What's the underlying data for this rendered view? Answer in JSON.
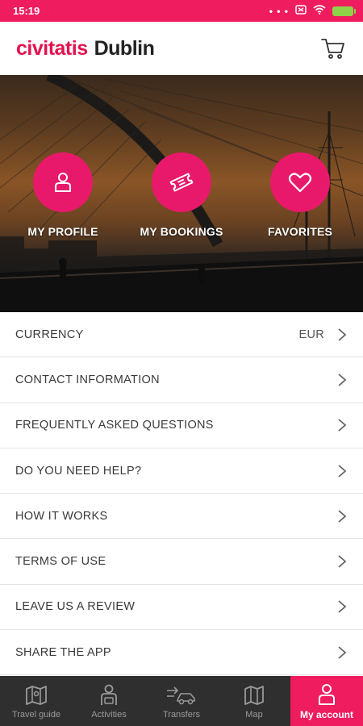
{
  "status_bar": {
    "time": "15:19",
    "dots": "• • •"
  },
  "header": {
    "brand": "civitatis",
    "city": "Dublin",
    "cart_icon": "cart-icon"
  },
  "hero": {
    "actions": [
      {
        "label": "MY PROFILE",
        "icon": "person-icon"
      },
      {
        "label": "MY BOOKINGS",
        "icon": "ticket-icon"
      },
      {
        "label": "FAVORITES",
        "icon": "heart-icon"
      }
    ]
  },
  "menu": {
    "items": [
      {
        "label": "CURRENCY",
        "value": "EUR"
      },
      {
        "label": "CONTACT INFORMATION"
      },
      {
        "label": "FREQUENTLY ASKED QUESTIONS"
      },
      {
        "label": "DO YOU NEED HELP?"
      },
      {
        "label": "HOW IT WORKS"
      },
      {
        "label": "TERMS OF USE"
      },
      {
        "label": "LEAVE US A REVIEW"
      },
      {
        "label": "SHARE THE APP"
      }
    ]
  },
  "bottom_nav": {
    "items": [
      {
        "label": "Travel guide",
        "icon": "map-book-icon"
      },
      {
        "label": "Activities",
        "icon": "guide-person-icon"
      },
      {
        "label": "Transfers",
        "icon": "transfer-car-icon"
      },
      {
        "label": "Map",
        "icon": "map-icon"
      },
      {
        "label": "My account",
        "icon": "account-icon",
        "active": true
      }
    ]
  },
  "colors": {
    "brand": "#e3124f",
    "accent": "#ef1c60",
    "nav_bg": "#2f2f2f"
  }
}
